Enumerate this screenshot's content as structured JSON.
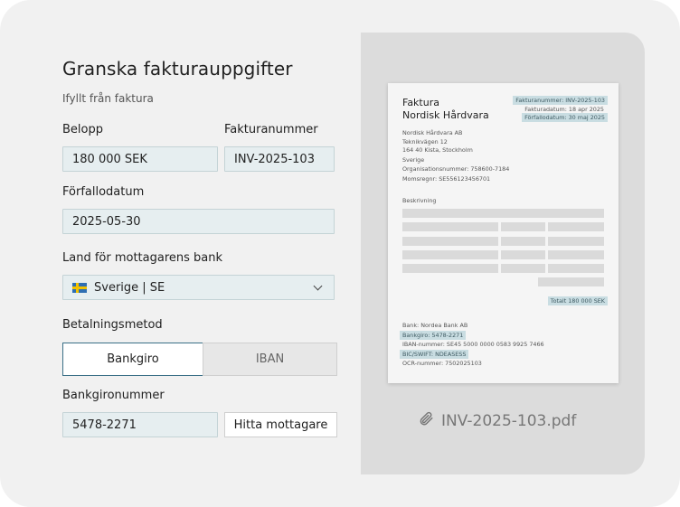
{
  "form": {
    "title": "Granska fakturauppgifter",
    "subtitle": "Ifyllt från faktura",
    "amount": {
      "label": "Belopp",
      "value": "180 000 SEK"
    },
    "invoice_number": {
      "label": "Fakturanummer",
      "value": "INV-2025-103"
    },
    "due_date": {
      "label": "Förfallodatum",
      "value": "2025-05-30"
    },
    "bank_country": {
      "label": "Land för mottagarens bank",
      "value": "Sverige | SE",
      "flag": "sweden-flag-icon"
    },
    "payment_method": {
      "label": "Betalningsmetod",
      "options": [
        "Bankgiro",
        "IBAN"
      ],
      "selected": "Bankgiro"
    },
    "bankgiro": {
      "label": "Bankgironummer",
      "value": "5478-2271",
      "button": "Hitta mottagare"
    }
  },
  "invoice": {
    "heading": "Faktura",
    "company": "Nordisk Hårdvara",
    "meta": [
      "Fakturanummer: INV-2025-103",
      "Fakturadatum: 18 apr 2025",
      "Förfallodatum: 30 maj 2025"
    ],
    "sender_lines": [
      "Nordisk Hårdvara AB",
      "Teknikvägen 12",
      "164 40 Kista, Stockholm",
      "Sverige",
      "Organisationsnummer: 758600-7184",
      "Momsregnr: SE556123456701"
    ],
    "description_label": "Beskrivning",
    "total": "Totalt 180 000 SEK",
    "bank_lines": [
      "Bank: Nordea Bank AB",
      "Bankgiro: 5478-2271",
      "IBAN-nummer: SE45 5000 0000 0583 9925 7466",
      "BIC/SWIFT: NDEASESS",
      "OCR-nummer: 7502025103"
    ]
  },
  "attachment": {
    "filename": "INV-2025-103.pdf",
    "icon": "paperclip-icon"
  },
  "colors": {
    "field_bg": "#e6eef0",
    "accent": "#3a6f86",
    "highlight": "#c9dde2"
  }
}
